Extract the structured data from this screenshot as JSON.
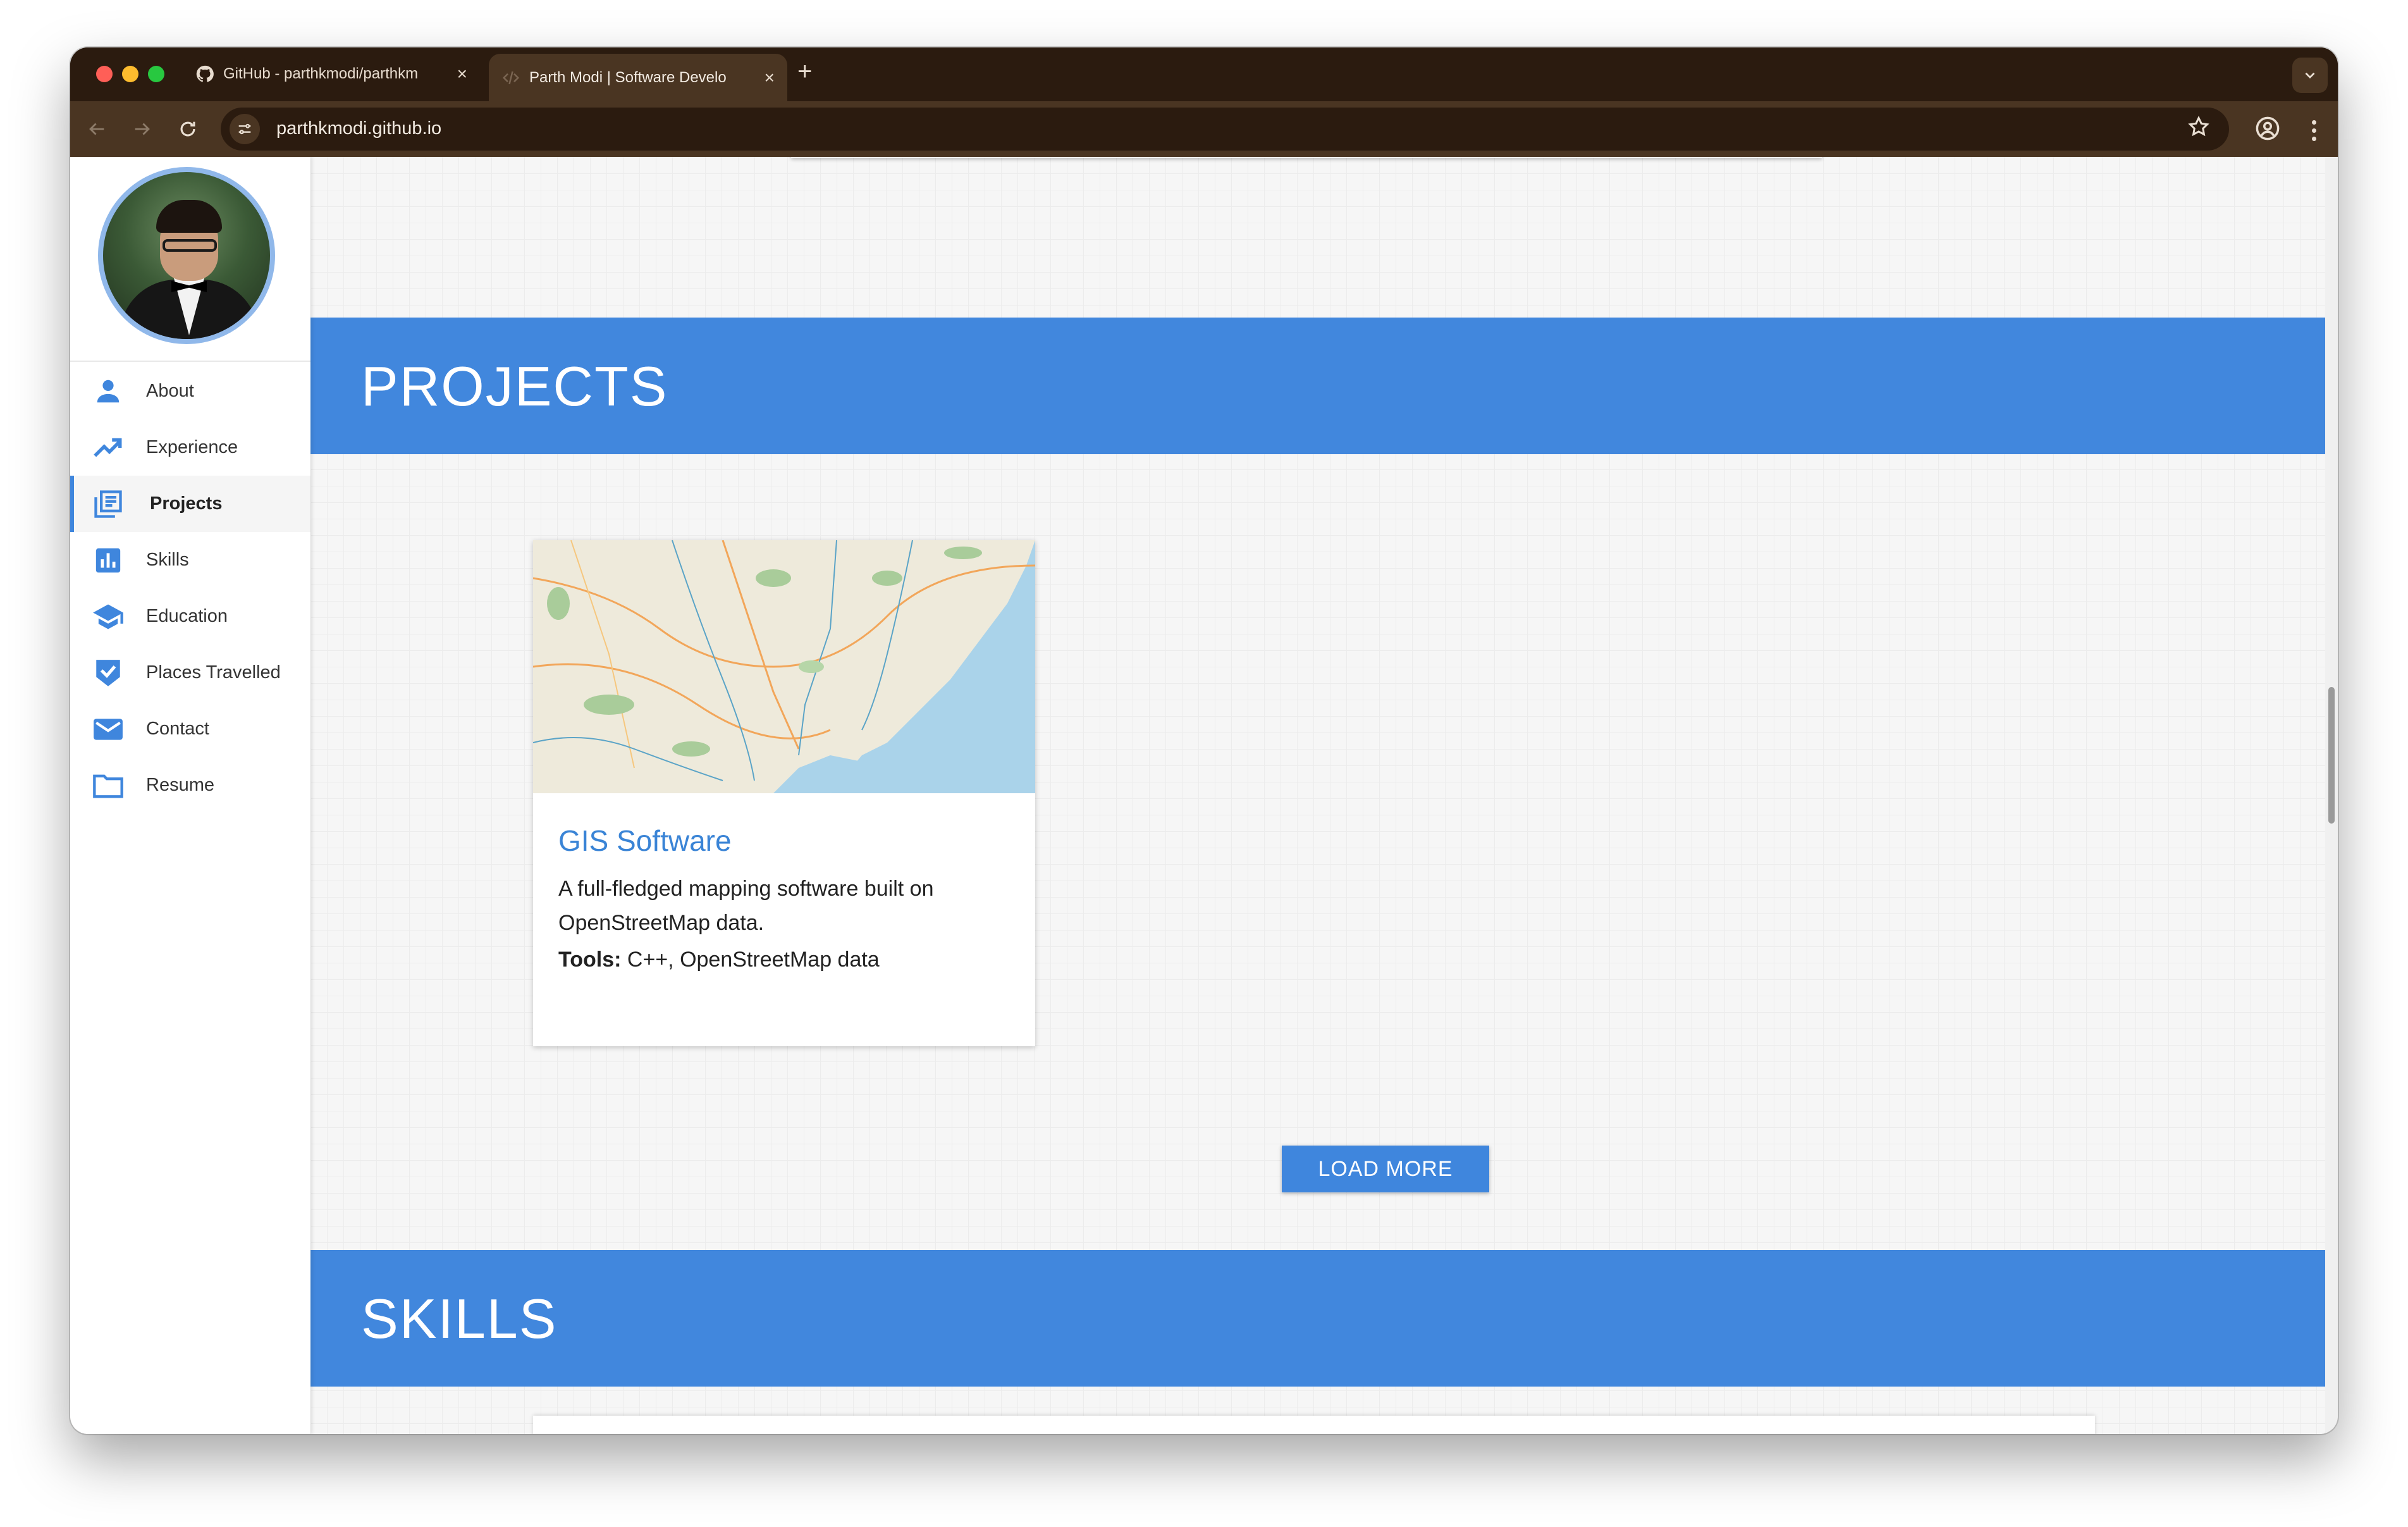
{
  "browser": {
    "tabs": [
      {
        "title": "GitHub - parthkmodi/parthkm",
        "icon": "github-icon"
      },
      {
        "title": "Parth Modi | Software Develo",
        "icon": "code-icon"
      }
    ],
    "url": "parthkmodi.github.io"
  },
  "sidebar": {
    "items": [
      {
        "label": "About",
        "icon": "person-icon"
      },
      {
        "label": "Experience",
        "icon": "trending-up-icon"
      },
      {
        "label": "Projects",
        "icon": "list-icon"
      },
      {
        "label": "Skills",
        "icon": "bar-chart-icon"
      },
      {
        "label": "Education",
        "icon": "graduation-cap-icon"
      },
      {
        "label": "Places Travelled",
        "icon": "check-badge-icon"
      },
      {
        "label": "Contact",
        "icon": "mail-icon"
      },
      {
        "label": "Resume",
        "icon": "folder-icon"
      }
    ],
    "active": "Projects"
  },
  "projects": {
    "heading": "PROJECTS",
    "cards": [
      {
        "title": "GIS Software",
        "description": "A full-fledged mapping software built on OpenStreetMap data.",
        "tools_label": "Tools:",
        "tools": " C++, OpenStreetMap data"
      }
    ],
    "load_more": "LOAD MORE"
  },
  "skills": {
    "heading": "SKILLS"
  },
  "colors": {
    "accent": "#4187dd",
    "link": "#3a84d6",
    "chrome": "#2b1b0f",
    "toolbar": "#4a3522"
  }
}
